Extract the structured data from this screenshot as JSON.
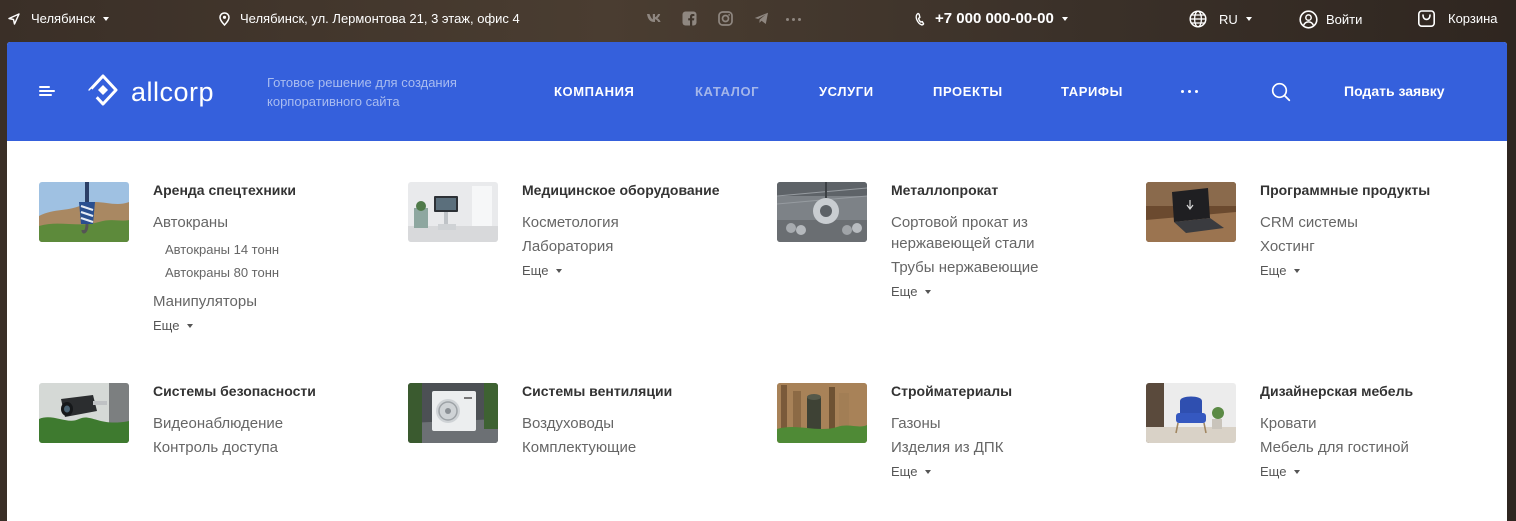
{
  "topbar": {
    "city": "Челябинск",
    "address": "Челябинск, ул. Лермонтова 21, 3 этаж, офис 4",
    "social_icons": [
      "vk-icon",
      "facebook-icon",
      "instagram-icon",
      "telegram-icon",
      "more-dots-icon"
    ],
    "phone": "+7 000 000-00-00",
    "language": "RU",
    "login": "Войти",
    "cart": "Корзина"
  },
  "header": {
    "logo_text": "allcorp",
    "tagline": "Готовое решение для создания корпоративного сайта",
    "nav": [
      {
        "label": "КОМПАНИЯ",
        "active": false
      },
      {
        "label": "КАТАЛОГ",
        "active": true
      },
      {
        "label": "УСЛУГИ",
        "active": false
      },
      {
        "label": "ПРОЕКТЫ",
        "active": false
      },
      {
        "label": "ТАРИФЫ",
        "active": false
      }
    ],
    "cta": "Подать заявку",
    "accent_color": "#3560dc"
  },
  "catalog": {
    "more_label": "Еще",
    "items": [
      {
        "title": "Аренда спецтехники",
        "subs": [
          "Автокраны"
        ],
        "subsubs": [
          "Автокраны 14 тонн",
          "Автокраны 80 тонн"
        ],
        "subs_after": [
          "Манипуляторы"
        ],
        "more": true
      },
      {
        "title": "Медицинское оборудование",
        "subs": [
          "Косметология",
          "Лаборатория"
        ],
        "more": true
      },
      {
        "title": "Металлопрокат",
        "subs": [
          "Сортовой прокат из нержавеющей стали",
          "Трубы нержавеющие"
        ],
        "more": true
      },
      {
        "title": "Программные продукты",
        "subs": [
          "CRM системы",
          "Хостинг"
        ],
        "more": true
      },
      {
        "title": "Системы безопасности",
        "subs": [
          "Видеонаблюдение",
          "Контроль доступа"
        ],
        "more": false
      },
      {
        "title": "Системы вентиляции",
        "subs": [
          "Воздуховоды",
          "Комплектующие"
        ],
        "more": false
      },
      {
        "title": "Стройматериалы",
        "subs": [
          "Газоны",
          "Изделия из ДПК"
        ],
        "more": true
      },
      {
        "title": "Дизайнерская мебель",
        "subs": [
          "Кровати",
          "Мебель для гостиной"
        ],
        "more": true
      }
    ]
  }
}
